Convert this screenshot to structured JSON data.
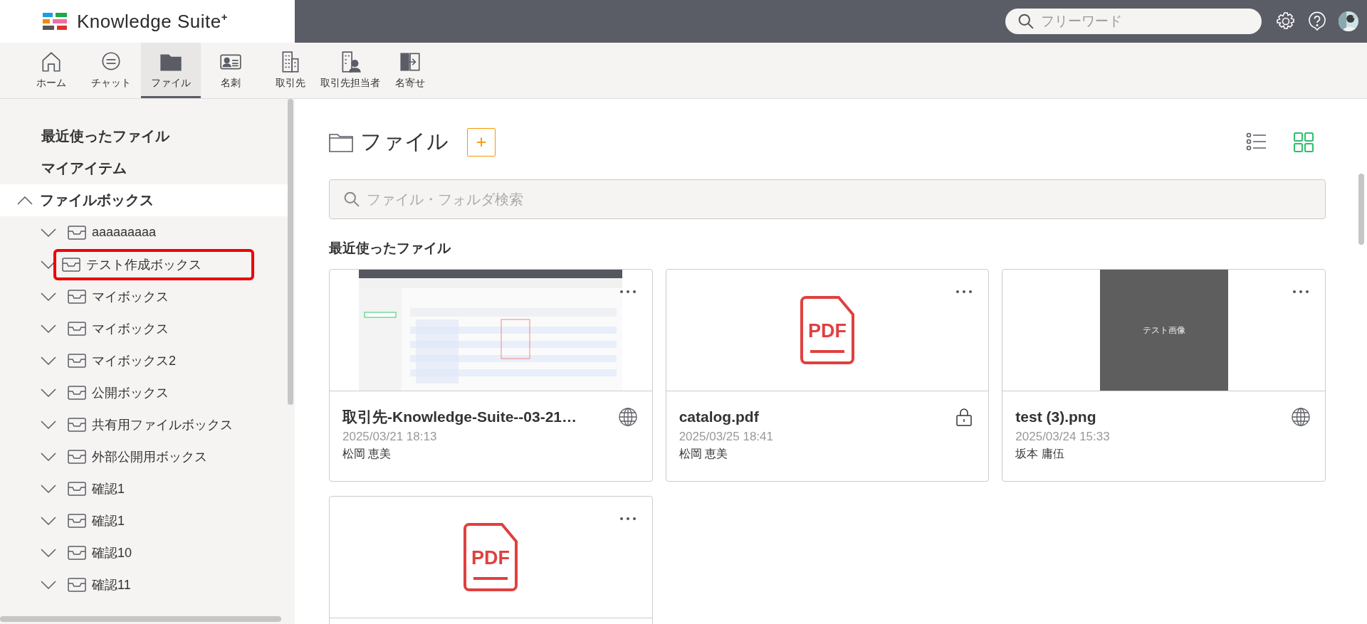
{
  "header": {
    "brand": "Knowledge Suite$^{+}$",
    "search": {
      "placeholder": "フリーワード"
    }
  },
  "nav": [
    {
      "label": "ホーム",
      "kind": "home",
      "selected": false
    },
    {
      "label": "チャット",
      "kind": "chat",
      "selected": false
    },
    {
      "label": "ファイル",
      "kind": "folder",
      "selected": true
    },
    {
      "label": "名刺",
      "kind": "card",
      "selected": false
    },
    {
      "label": "取引先",
      "kind": "building",
      "selected": false
    },
    {
      "label": "取引先担当者",
      "kind": "contact",
      "selected": false
    },
    {
      "label": "名寄せ",
      "kind": "merge",
      "selected": false
    }
  ],
  "sidebar": {
    "sections": [
      {
        "label": "最近使ったファイル"
      },
      {
        "label": "マイアイテム"
      }
    ],
    "tree": {
      "label": "ファイルボックス",
      "expanded": true,
      "children": [
        {
          "label": "aaaaaaaaa",
          "expanded": false,
          "highlighted": false
        },
        {
          "label": "テスト作成ボックス",
          "expanded": false,
          "highlighted": true
        },
        {
          "label": "マイボックス",
          "expanded": false,
          "highlighted": false
        },
        {
          "label": "マイボックス",
          "expanded": false,
          "highlighted": false
        },
        {
          "label": "マイボックス2",
          "expanded": false,
          "highlighted": false
        },
        {
          "label": "公開ボックス",
          "expanded": false,
          "highlighted": false
        },
        {
          "label": "共有用ファイルボックス",
          "expanded": false,
          "highlighted": false
        },
        {
          "label": "外部公開用ボックス",
          "expanded": false,
          "highlighted": false
        },
        {
          "label": "確認1",
          "expanded": false,
          "highlighted": false
        },
        {
          "label": "確認1",
          "expanded": false,
          "highlighted": false
        },
        {
          "label": "確認10",
          "expanded": false,
          "highlighted": false
        },
        {
          "label": "確認11",
          "expanded": false,
          "highlighted": false
        }
      ]
    }
  },
  "main": {
    "title": "ファイル",
    "add_button": "+",
    "views": [
      {
        "kind": "list",
        "selected": false
      },
      {
        "kind": "grid",
        "selected": true
      }
    ],
    "search": {
      "placeholder": "ファイル・フォルダ検索"
    },
    "section_title": "最近使ったファイル",
    "cards": [
      {
        "name": "取引先-Knowledge-Suite--03-21…",
        "date": "2025/03/21 18:13",
        "owner": "松岡 恵美",
        "badge": {
          "kind": "globe"
        },
        "thumbnail": {
          "kind": "screenshot"
        }
      },
      {
        "name": "catalog.pdf",
        "date": "2025/03/25 18:41",
        "owner": "松岡 恵美",
        "badge": {
          "kind": "lock"
        },
        "thumbnail": {
          "kind": "pdf",
          "label": "PDF"
        }
      },
      {
        "name": "test (3).png",
        "date": "2025/03/24 15:33",
        "owner": "坂本 庸伍",
        "badge": {
          "kind": "globe"
        },
        "thumbnail": {
          "caption": "テスト画像"
        }
      },
      {
        "thumbnail": {
          "kind": "pdf",
          "label": "PDF"
        }
      }
    ]
  }
}
